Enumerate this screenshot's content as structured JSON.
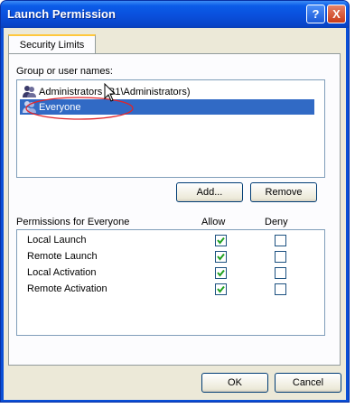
{
  "window": {
    "title": "Launch Permission",
    "help_label": "?",
    "close_label": "X"
  },
  "tab": {
    "label": "Security Limits"
  },
  "groups": {
    "label": "Group or user names:",
    "items": [
      {
        "name": "Administrators (B1\\Administrators)",
        "selected": false,
        "icon": "user-group-icon"
      },
      {
        "name": "Everyone",
        "selected": true,
        "icon": "user-group-icon"
      }
    ]
  },
  "buttons": {
    "add": "Add...",
    "remove": "Remove",
    "ok": "OK",
    "cancel": "Cancel"
  },
  "permissions": {
    "title": "Permissions for Everyone",
    "allow_header": "Allow",
    "deny_header": "Deny",
    "rows": [
      {
        "name": "Local Launch",
        "allow": true,
        "deny": false
      },
      {
        "name": "Remote Launch",
        "allow": true,
        "deny": false
      },
      {
        "name": "Local Activation",
        "allow": true,
        "deny": false
      },
      {
        "name": "Remote Activation",
        "allow": true,
        "deny": false
      }
    ]
  },
  "colors": {
    "title_bar": "#0a4fdc",
    "selection": "#316ac5",
    "annotation": "#e0242a",
    "check": "#21a121"
  }
}
